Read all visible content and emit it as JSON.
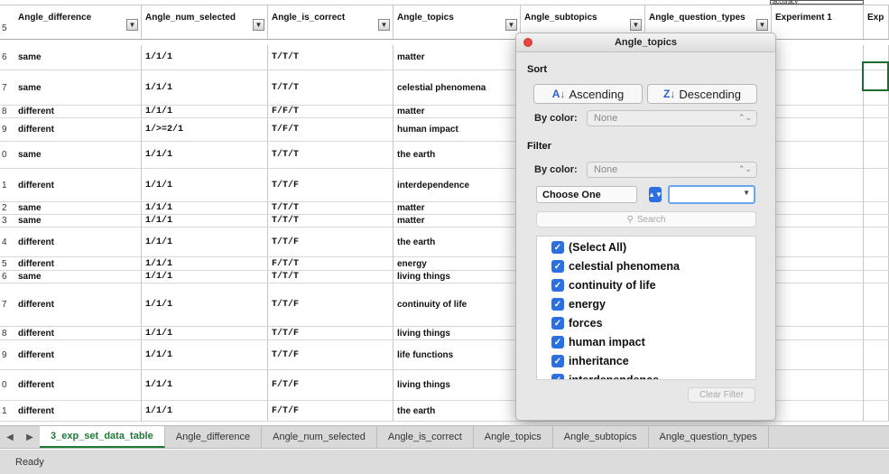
{
  "header_row": {
    "row_num": "5",
    "columns": [
      {
        "label": "Angle_difference",
        "filter": true
      },
      {
        "label": "Angle_num_selected",
        "filter": true
      },
      {
        "label": "Angle_is_correct",
        "filter": true
      },
      {
        "label": "Angle_topics",
        "filter": true
      },
      {
        "label": "Angle_subtopics",
        "filter": true
      },
      {
        "label": "Angle_question_types",
        "filter": true
      },
      {
        "label": "Experiment 1",
        "filter": false
      },
      {
        "label": "Exp",
        "filter": false
      }
    ],
    "top_cell_value": "accuracy"
  },
  "rows": [
    {
      "num": "6",
      "cells": [
        "same",
        "1/1/1",
        "T/T/T",
        "matter"
      ]
    },
    {
      "num": "7",
      "cells": [
        "same",
        "1/1/1",
        "T/T/T",
        "celestial phenomena"
      ]
    },
    {
      "num": "8",
      "cells": [
        "different",
        "1/1/1",
        "F/F/T",
        "matter"
      ]
    },
    {
      "num": "9",
      "cells": [
        "different",
        "1/>=2/1",
        "T/F/T",
        "human impact"
      ]
    },
    {
      "num": "0",
      "cells": [
        "same",
        "1/1/1",
        "T/T/T",
        "the earth"
      ]
    },
    {
      "num": "1",
      "cells": [
        "different",
        "1/1/1",
        "T/T/F",
        "interdependence"
      ]
    },
    {
      "num": "2",
      "cells": [
        "same",
        "1/1/1",
        "T/T/T",
        "matter"
      ]
    },
    {
      "num": "3",
      "cells": [
        "same",
        "1/1/1",
        "T/T/T",
        "matter"
      ]
    },
    {
      "num": "4",
      "cells": [
        "different",
        "1/1/1",
        "T/T/F",
        "the earth"
      ]
    },
    {
      "num": "5",
      "cells": [
        "different",
        "1/1/1",
        "F/T/T",
        "energy"
      ]
    },
    {
      "num": "6",
      "cells": [
        "same",
        "1/1/1",
        "T/T/T",
        "living things"
      ]
    },
    {
      "num": "7",
      "cells": [
        "different",
        "1/1/1",
        "T/T/F",
        "continuity of life"
      ]
    },
    {
      "num": "8",
      "cells": [
        "different",
        "1/1/1",
        "T/T/F",
        "living things"
      ]
    },
    {
      "num": "9",
      "cells": [
        "different",
        "1/1/1",
        "T/T/F",
        "life functions"
      ]
    },
    {
      "num": "0",
      "cells": [
        "different",
        "1/1/1",
        "F/T/F",
        "living things"
      ]
    },
    {
      "num": "1",
      "cells": [
        "different",
        "1/1/1",
        "F/T/F",
        "the earth"
      ]
    }
  ],
  "popup": {
    "title": "Angle_topics",
    "sort_label": "Sort",
    "ascending_label": "Ascending",
    "descending_label": "Descending",
    "sort_by_color_label": "By color:",
    "sort_by_color_value": "None",
    "filter_label": "Filter",
    "filter_by_color_label": "By color:",
    "filter_by_color_value": "None",
    "condition_value": "Choose One",
    "criteria_value": "",
    "search_placeholder": "Search",
    "items": [
      {
        "label": "(Select All)",
        "checked": true
      },
      {
        "label": "celestial phenomena",
        "checked": true
      },
      {
        "label": "continuity of life",
        "checked": true
      },
      {
        "label": "energy",
        "checked": true
      },
      {
        "label": "forces",
        "checked": true
      },
      {
        "label": "human impact",
        "checked": true
      },
      {
        "label": "inheritance",
        "checked": true
      },
      {
        "label": "interdependence",
        "checked": true
      }
    ],
    "clear_filter_label": "Clear Filter"
  },
  "tabs": [
    {
      "label": "3_exp_set_data_table",
      "active": true
    },
    {
      "label": "Angle_difference",
      "active": false
    },
    {
      "label": "Angle_num_selected",
      "active": false
    },
    {
      "label": "Angle_is_correct",
      "active": false
    },
    {
      "label": "Angle_topics",
      "active": false
    },
    {
      "label": "Angle_subtopics",
      "active": false
    },
    {
      "label": "Angle_question_types",
      "active": false
    }
  ],
  "status": "Ready"
}
